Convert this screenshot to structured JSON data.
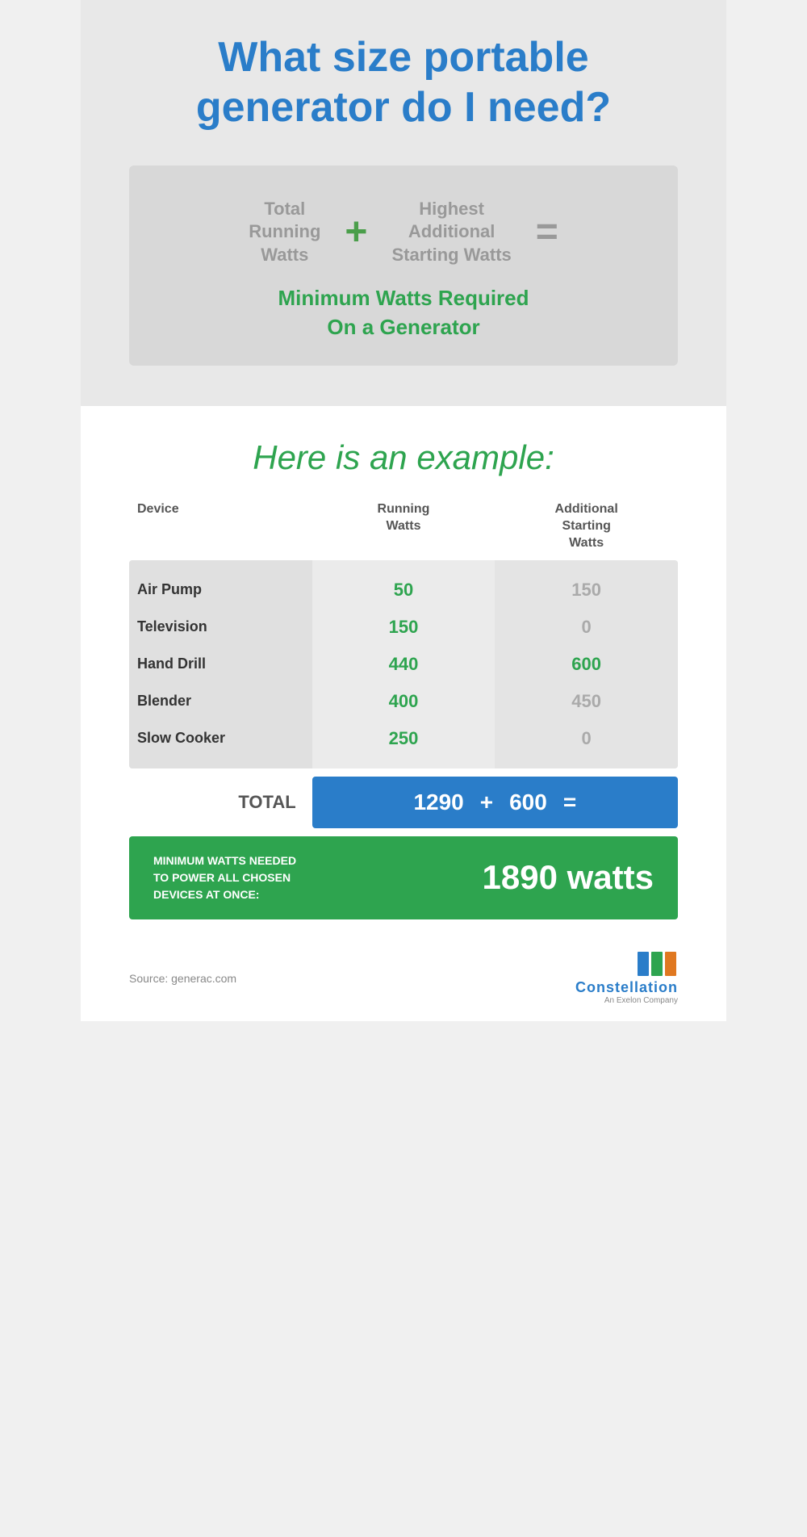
{
  "header": {
    "title_line1": "What size portable",
    "title_line2": "generator do I need?"
  },
  "formula": {
    "term1_line1": "Total",
    "term1_line2": "Running",
    "term1_line3": "Watts",
    "plus_operator": "+",
    "term2_line1": "Highest",
    "term2_line2": "Additional",
    "term2_line3": "Starting Watts",
    "equals_operator": "=",
    "result_line1": "Minimum Watts Required",
    "result_line2": "On a Generator"
  },
  "example": {
    "title": "Here is an example:",
    "table": {
      "col1_header": "Device",
      "col2_header": "Running\nWatts",
      "col3_header": "Additional\nStarting\nWatts",
      "rows": [
        {
          "device": "Air Pump",
          "running": "50",
          "starting": "150",
          "starting_green": false
        },
        {
          "device": "Television",
          "running": "150",
          "starting": "0",
          "starting_green": false
        },
        {
          "device": "Hand Drill",
          "running": "440",
          "starting": "600",
          "starting_green": true
        },
        {
          "device": "Blender",
          "running": "400",
          "starting": "450",
          "starting_green": false
        },
        {
          "device": "Slow Cooker",
          "running": "250",
          "starting": "0",
          "starting_green": false
        }
      ]
    },
    "total_label": "TOTAL",
    "total_running": "1290",
    "total_plus": "+",
    "total_starting": "600",
    "total_equals": "=",
    "min_label": "MINIMUM WATTS NEEDED\nTO POWER ALL CHOSEN\nDEVICES AT ONCE:",
    "min_value": "1890 watts"
  },
  "footer": {
    "source": "Source: generac.com",
    "logo_name": "Constellation",
    "logo_sub": "An Exelon Company"
  },
  "colors": {
    "blue": "#2a7dc9",
    "green": "#2ea44f",
    "gray": "#999",
    "light_green": "#2ea44f"
  }
}
